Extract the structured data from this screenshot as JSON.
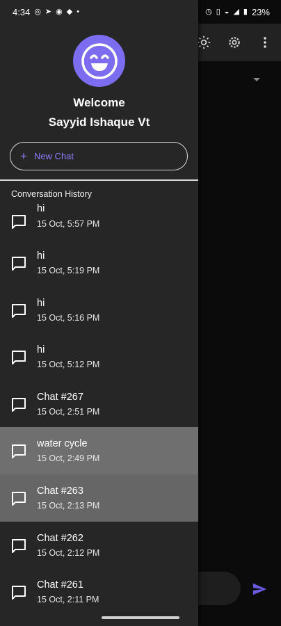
{
  "status_bar": {
    "time": "4:34",
    "battery": "23%",
    "left_icons": [
      "whatsapp-icon",
      "telegram-icon",
      "location-icon",
      "game-icon",
      "dot-icon"
    ],
    "right_icons": [
      "alarm-icon",
      "vibrate-icon",
      "hotspot-icon",
      "signal-icon",
      "battery-icon"
    ]
  },
  "toolbar": {
    "icons": [
      "brightness-icon",
      "settings-icon",
      "more-icon"
    ]
  },
  "drawer": {
    "welcome_line1": "Welcome",
    "welcome_line2": "Sayyid Ishaque Vt",
    "new_chat_label": "New Chat",
    "history_heading": "Conversation History",
    "conversations": [
      {
        "title": "hi",
        "date": "15 Oct, 5:57 PM"
      },
      {
        "title": "hi",
        "date": "15 Oct, 5:19 PM"
      },
      {
        "title": "hi",
        "date": "15 Oct, 5:16 PM"
      },
      {
        "title": "hi",
        "date": "15 Oct, 5:12 PM"
      },
      {
        "title": "Chat #267",
        "date": "15 Oct, 2:51 PM"
      },
      {
        "title": "water cycle",
        "date": "15 Oct, 2:49 PM"
      },
      {
        "title": "Chat #263",
        "date": "15 Oct, 2:13 PM"
      },
      {
        "title": "Chat #262",
        "date": "15 Oct, 2:12 PM"
      },
      {
        "title": "Chat #261",
        "date": "15 Oct, 2:11 PM"
      }
    ]
  },
  "colors": {
    "accent": "#7b6cf0",
    "drawer_bg": "#262626",
    "selected_bg": "#6f6f6f"
  }
}
